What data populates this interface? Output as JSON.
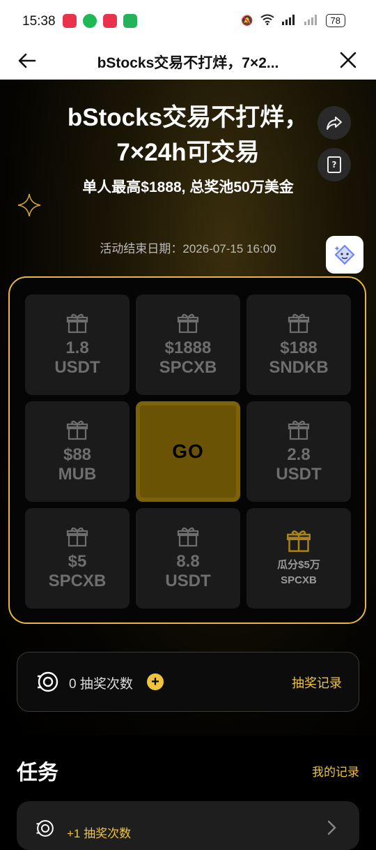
{
  "status_bar": {
    "time": "15:38",
    "battery": "78"
  },
  "navbar": {
    "title": "bStocks交易不打烊，7×2...",
    "back_icon": "arrow-left-icon",
    "close_icon": "close-icon"
  },
  "hero": {
    "title": "bStocks交易不打烊，7×24h可交易",
    "subtitle": "单人最高$1888, 总奖池50万美金",
    "end_date": "活动结束日期：2026-07-15 16:00"
  },
  "prize_grid": [
    {
      "amount": "1.8",
      "unit": "USDT"
    },
    {
      "amount": "$1888",
      "unit": "SPCXB"
    },
    {
      "amount": "$188",
      "unit": "SNDKB"
    },
    {
      "amount": "$88",
      "unit": "MUB"
    },
    {
      "go_label": "GO"
    },
    {
      "amount": "2.8",
      "unit": "USDT"
    },
    {
      "amount": "$5",
      "unit": "SPCXB"
    },
    {
      "amount": "8.8",
      "unit": "USDT"
    },
    {
      "amount": "瓜分$5万",
      "unit": "SPCXB"
    }
  ],
  "draw": {
    "count_text": "0 抽奖次数",
    "plus": "+",
    "record": "抽奖记录"
  },
  "tasks": {
    "title": "任务",
    "my_record": "我的记录",
    "items": [
      {
        "label": "+1 抽奖次数"
      }
    ]
  },
  "colors": {
    "accent": "#f0c33c",
    "border": "#e7b83a",
    "go_bg": "#6b5306"
  }
}
